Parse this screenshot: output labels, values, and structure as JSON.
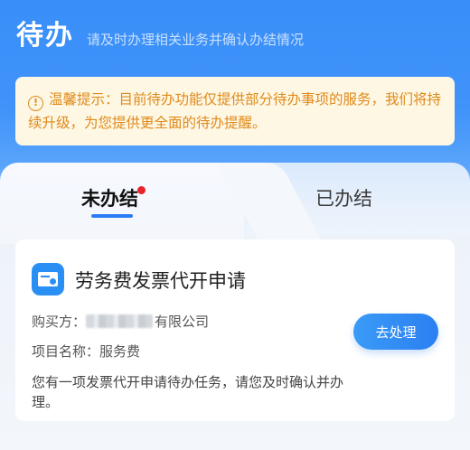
{
  "header": {
    "title": "待办",
    "subtitle": "请及时办理相关业务并确认办结情况"
  },
  "notice": {
    "icon": "exclamation-circle-icon",
    "text": "温馨提示：目前待办功能仅提供部分待办事项的服务，我们将持续升级，为您提供更全面的待办提醒。"
  },
  "tabs": [
    {
      "label": "未办结",
      "active": true,
      "has_badge": true
    },
    {
      "label": "已办结",
      "active": false,
      "has_badge": false
    }
  ],
  "card": {
    "icon": "invoice-icon",
    "title": "劳务费发票代开申请",
    "buyer_label": "购买方：",
    "buyer_value_suffix": "有限公司",
    "item_label": "项目名称：",
    "item_value": "服务费",
    "description": "您有一项发票代开申请待办任务，请您及时确认并办理。",
    "action_label": "去处理"
  },
  "colors": {
    "primary": "#2b7cf4",
    "notice_text": "#e08a1a",
    "notice_bg": "#fdf7e4",
    "badge": "#e8232b"
  }
}
